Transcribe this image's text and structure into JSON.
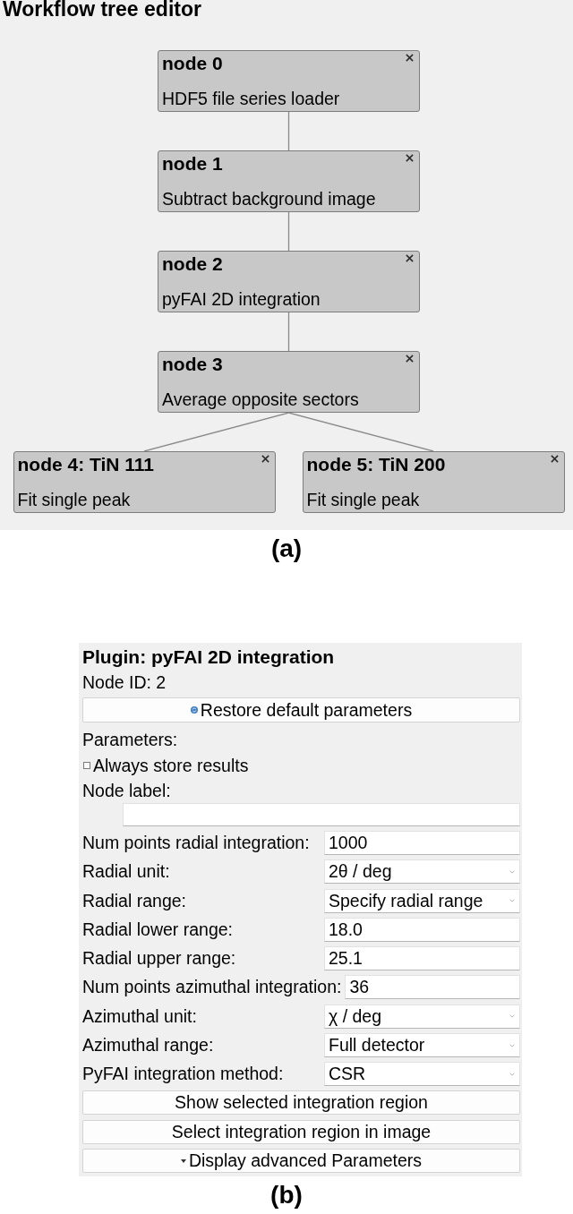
{
  "tree_editor": {
    "title": "Workflow tree editor",
    "root": {
      "title": "node 0",
      "description": "HDF5 file series loader",
      "children": [
        {
          "title": "node 1",
          "description": "Subtract background image",
          "children": [
            {
              "title": "node 2",
              "description": "pyFAI 2D integration",
              "children": [
                {
                  "title": "node 3",
                  "description": "Average opposite sectors",
                  "children": [
                    {
                      "title": "node 4: TiN 111",
                      "description": "Fit single peak"
                    },
                    {
                      "title": "node 5: TiN 200",
                      "description": "Fit single peak"
                    }
                  ]
                }
              ]
            }
          ]
        }
      ]
    }
  },
  "caption_a": "(a)",
  "plugin_panel": {
    "title": "Plugin: pyFAI 2D integration",
    "node_id": "Node ID: 2",
    "restore_button": {
      "label": "Restore default parameters"
    },
    "parameters_heading": "Parameters:",
    "always_store": {
      "label": "Always store results",
      "checked": false
    },
    "node_label": {
      "label": "Node label:"
    },
    "fields": [
      {
        "label": "Num points radial integration:",
        "kind": "input",
        "value": "1000"
      },
      {
        "label": "Radial unit:",
        "kind": "combo",
        "value": "2θ / deg"
      },
      {
        "label": "Radial range:",
        "kind": "combo",
        "value": "Specify radial range"
      },
      {
        "label": "Radial lower range:",
        "kind": "input",
        "value": "18.0"
      },
      {
        "label": "Radial upper range:",
        "kind": "input",
        "value": "25.1"
      },
      {
        "label": "Num points azimuthal integration:",
        "kind": "input",
        "value": "36"
      },
      {
        "label": "Azimuthal unit:",
        "kind": "combo",
        "value": "χ / deg"
      },
      {
        "label": "Azimuthal range:",
        "kind": "combo",
        "value": "Full detector"
      },
      {
        "label": "PyFAI integration method:",
        "kind": "combo",
        "value": "CSR"
      }
    ],
    "buttons": [
      {
        "label": "Show selected integration region",
        "kind": "plain"
      },
      {
        "label": "Select integration region in image",
        "kind": "plain"
      },
      {
        "label": "Display advanced Parameters",
        "kind": "expander"
      }
    ]
  },
  "caption_b": "(b)"
}
